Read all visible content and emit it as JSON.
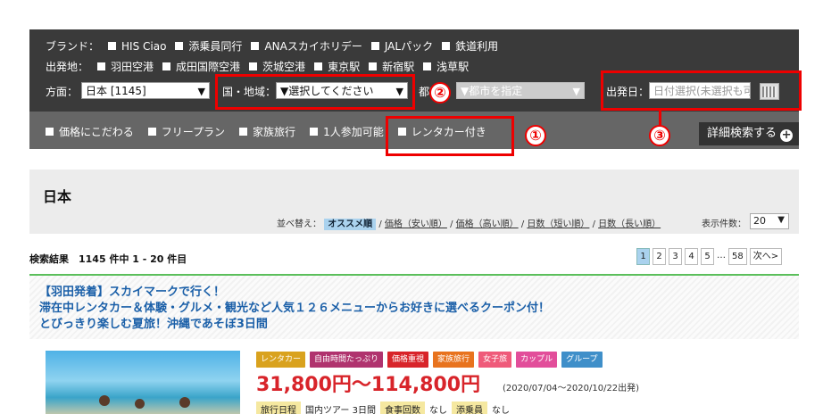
{
  "search": {
    "brand_label": "ブランド：",
    "brands": [
      "HIS Ciao",
      "添乗員同行",
      "ANAスカイホリデー",
      "JALパック",
      "鉄道利用"
    ],
    "departure_label": "出発地：",
    "departures": [
      "羽田空港",
      "成田国際空港",
      "茨城空港",
      "東京駅",
      "新宿駅",
      "浅草駅"
    ],
    "direction_label": "方面：",
    "direction_value": "日本 [1145]",
    "country_label": "国・地域：",
    "country_value": "▼選択してください",
    "city_label": "都市：",
    "city_value": "▼都市を指定",
    "date_label": "出発日：",
    "date_placeholder": "日付選択(未選択も可)",
    "options": [
      "価格にこだわる",
      "フリープラン",
      "家族旅行",
      "1人参加可能",
      "レンタカー付き"
    ],
    "detail_button": "詳細検索する",
    "detail_icon": "plus-circle-icon"
  },
  "annotations": {
    "color": "#e00000",
    "markers": [
      "①",
      "②",
      "③"
    ]
  },
  "region": {
    "title": "日本",
    "sort_label": "並べ替え：",
    "sort_active": "オススメ順",
    "sort_options": [
      "価格（安い順）",
      "価格（高い順）",
      "日数（短い順）",
      "日数（長い順）"
    ],
    "count_label": "表示件数：",
    "count_value": "20"
  },
  "results": {
    "summary": "検索結果　1145 件中 1 - 20 件目",
    "pages": [
      "1",
      "2",
      "3",
      "4",
      "5",
      "…",
      "58",
      "次へ>"
    ],
    "current_page": "1"
  },
  "tour": {
    "title_lines": [
      "【羽田発着】スカイマークで行く！",
      "滞在中レンタカー＆体験・グルメ・観光など人気１２６メニューからお好きに選べるクーポン付！",
      "とびっきり楽しむ夏旅！沖縄であそぼ3日間"
    ],
    "tags": [
      {
        "label": "レンタカー",
        "color": "#d9a21e"
      },
      {
        "label": "自由時間たっぷり",
        "color": "#b0336e"
      },
      {
        "label": "価格重視",
        "color": "#d8242a"
      },
      {
        "label": "家族旅行",
        "color": "#e8731e"
      },
      {
        "label": "女子旅",
        "color": "#ef5a7a"
      },
      {
        "label": "カップル",
        "color": "#e24e9a"
      },
      {
        "label": "グループ",
        "color": "#3f8fc9"
      }
    ],
    "price": "31,800円〜114,800円",
    "date_range": "(2020/07/04〜2020/10/22出発)",
    "specs": [
      {
        "key": "旅行日程",
        "value": "国内ツアー 3日間"
      },
      {
        "key": "食事回数",
        "value": "なし"
      },
      {
        "key": "添乗員",
        "value": "なし"
      }
    ]
  }
}
